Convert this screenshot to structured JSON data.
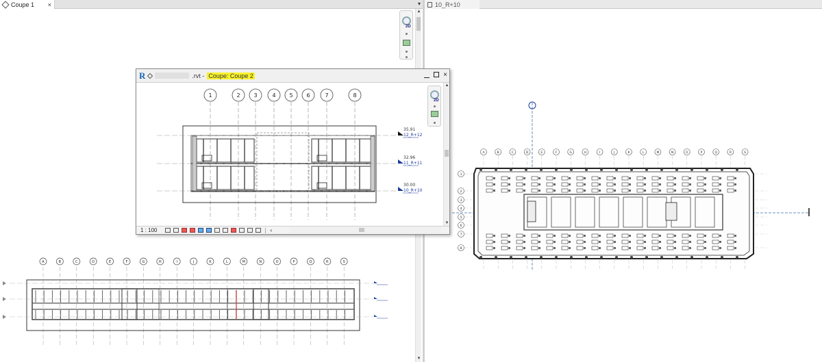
{
  "tabs_left": {
    "active_tab": "Coupe 1",
    "close_glyph": "×",
    "dropdown_glyph": "▾"
  },
  "tabs_right": {
    "tab": "10_R+10"
  },
  "nav_widget": {
    "label_2d": "2D"
  },
  "float_window": {
    "logo": "R",
    "filename": ".rvt -",
    "view_title": "Coupe: Coupe 2",
    "scale": "1 : 100",
    "grid_labels": [
      "1",
      "2",
      "3",
      "4",
      "5",
      "6",
      "7",
      "8"
    ],
    "levels": [
      {
        "elevation": "35.91",
        "name": "12_R+12"
      },
      {
        "elevation": "32.96",
        "name": "11_R+11"
      },
      {
        "elevation": "30.00",
        "name": "10_R+10"
      }
    ]
  },
  "section_view": {
    "grid_labels": [
      "A",
      "B",
      "C",
      "D",
      "E",
      "F",
      "G",
      "H",
      "I",
      "J",
      "K",
      "L",
      "M",
      "N",
      "O",
      "P",
      "Q",
      "R",
      "S"
    ]
  },
  "plan_view": {
    "top_grid_labels": [
      "A",
      "B",
      "C",
      "D",
      "E",
      "F",
      "G",
      "H",
      "I",
      "J",
      "K",
      "L",
      "M",
      "N",
      "O",
      "P",
      "Q",
      "R",
      "S"
    ],
    "left_grid_labels": [
      "1",
      "2",
      "3",
      "4",
      "5",
      "6",
      "7",
      "8"
    ]
  },
  "colors": {
    "accent_blue": "#1766b4",
    "highlight_yellow": "#f7f22a",
    "level_blue": "#1a3c9c"
  }
}
